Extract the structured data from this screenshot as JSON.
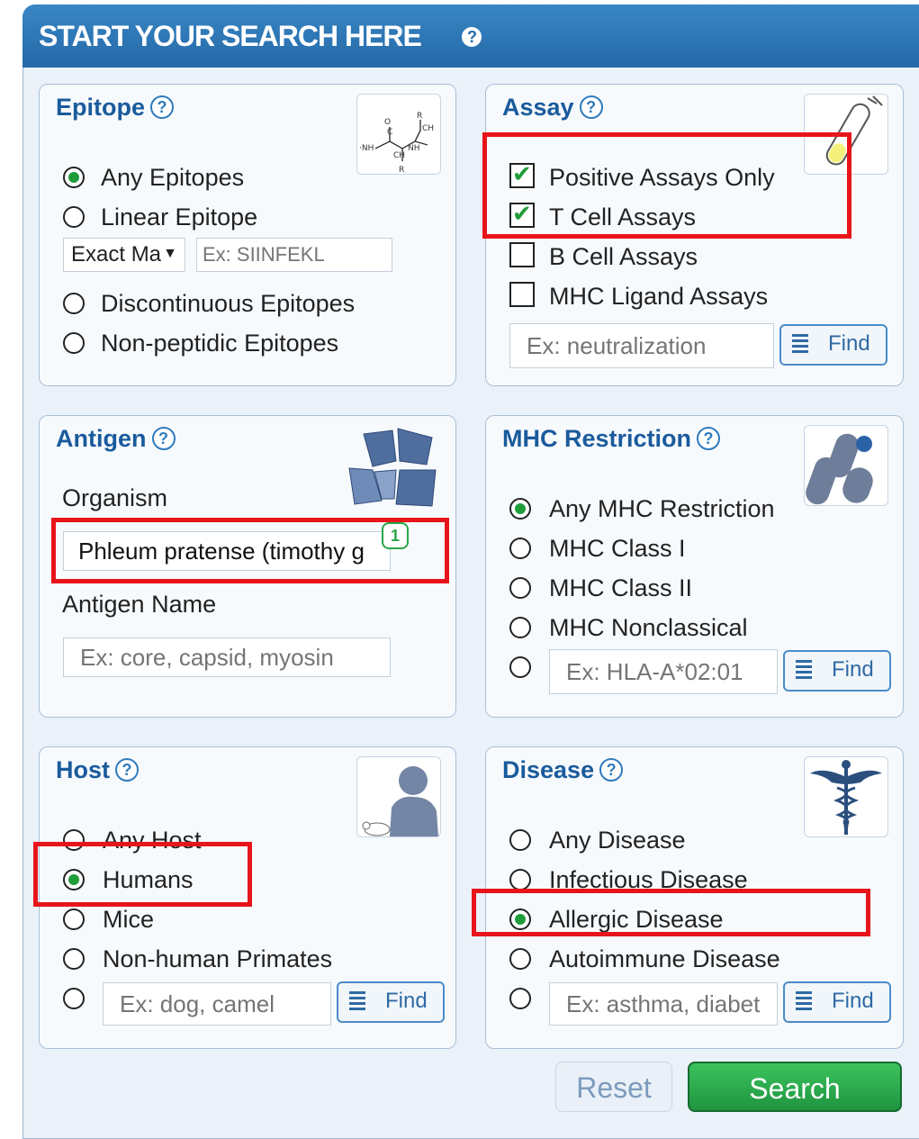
{
  "header": {
    "title": "START YOUR SEARCH HERE",
    "help": "?"
  },
  "epitope": {
    "title": "Epitope",
    "help": "?",
    "options": [
      "Any Epitopes",
      "Linear Epitope",
      "Discontinuous Epitopes",
      "Non-peptidic Epitopes"
    ],
    "selected": "Any Epitopes",
    "match_select": "Exact Ma",
    "sequence_placeholder": "Ex: SIINFEKL"
  },
  "assay": {
    "title": "Assay",
    "help": "?",
    "checks": [
      {
        "label": "Positive Assays Only",
        "checked": true
      },
      {
        "label": "T Cell Assays",
        "checked": true
      },
      {
        "label": "B Cell Assays",
        "checked": false
      },
      {
        "label": "MHC Ligand Assays",
        "checked": false
      }
    ],
    "input_placeholder": "Ex: neutralization",
    "find_label": "Find"
  },
  "antigen": {
    "title": "Antigen",
    "help": "?",
    "organism_label": "Organism",
    "organism_value": "Phleum pratense (timothy g",
    "organism_badge": "1",
    "antigen_name_label": "Antigen Name",
    "antigen_name_placeholder": "Ex: core, capsid, myosin"
  },
  "mhc": {
    "title": "MHC Restriction",
    "help": "?",
    "options": [
      "Any MHC Restriction",
      "MHC Class I",
      "MHC Class II",
      "MHC Nonclassical"
    ],
    "selected": "Any MHC Restriction",
    "input_placeholder": "Ex: HLA-A*02:01",
    "find_label": "Find"
  },
  "host": {
    "title": "Host",
    "help": "?",
    "options": [
      "Any Host",
      "Humans",
      "Mice",
      "Non-human Primates"
    ],
    "selected": "Humans",
    "input_placeholder": "Ex: dog, camel",
    "find_label": "Find"
  },
  "disease": {
    "title": "Disease",
    "help": "?",
    "options": [
      "Any Disease",
      "Infectious Disease",
      "Allergic Disease",
      "Autoimmune Disease"
    ],
    "selected": "Allergic Disease",
    "input_placeholder": "Ex: asthma, diabet",
    "find_label": "Find"
  },
  "actions": {
    "reset_label": "Reset",
    "search_label": "Search"
  },
  "colors": {
    "accent": "#2468a8",
    "selected": "#1f9d3a",
    "highlight": "#e8141b",
    "search_button": "#2aa64a"
  }
}
